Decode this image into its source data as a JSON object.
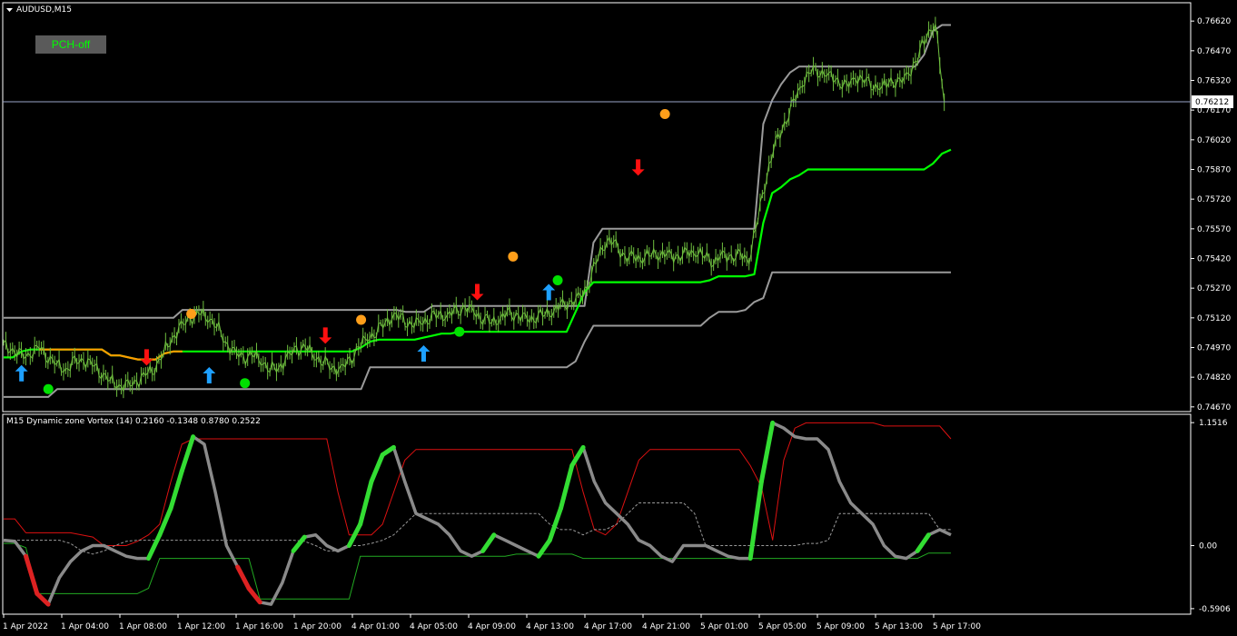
{
  "window": {
    "title": "AUDUSD,M15"
  },
  "button": {
    "label": "PCH-off"
  },
  "indicator": {
    "title": "M15 Dynamic zone Vortex (14) 0.2160 -0.1348 0.8780 0.2522"
  },
  "colors": {
    "background": "#000000",
    "frame": "#ffffff",
    "price": "#6fbf3f",
    "channel": "#9a9a9a",
    "baseline": "#00ff00",
    "baseline_alt": "#ff9900",
    "up_arrow": "#1ea0ff",
    "down_arrow": "#ff1010",
    "dot_green": "#00e000",
    "dot_orange": "#ff9f1a",
    "vortex": "#8a8a8a",
    "vortex_up": "#33dd33",
    "vortex_down": "#dd2222",
    "upper_zone": "#dd1111",
    "lower_zone": "#22aa22",
    "mid_zone": "#999999"
  },
  "chart_data": [
    {
      "type": "line",
      "title": "AUDUSD,M15",
      "x_labels": [
        "1 Apr 2022",
        "1 Apr 04:00",
        "1 Apr 08:00",
        "1 Apr 12:00",
        "1 Apr 16:00",
        "1 Apr 20:00",
        "4 Apr 01:00",
        "4 Apr 05:00",
        "4 Apr 09:00",
        "4 Apr 13:00",
        "4 Apr 17:00",
        "4 Apr 21:00",
        "5 Apr 01:00",
        "5 Apr 05:00",
        "5 Apr 09:00",
        "5 Apr 13:00",
        "5 Apr 17:00"
      ],
      "y_ticks": [
        "0.76620",
        "0.76470",
        "0.76320",
        "0.76170",
        "0.76020",
        "0.75870",
        "0.75720",
        "0.75570",
        "0.75420",
        "0.75270",
        "0.75120",
        "0.74970",
        "0.74820",
        "0.74670"
      ],
      "ylim": [
        0.7466,
        0.7663
      ],
      "current_price": "0.76212",
      "current_value": 0.76212,
      "series": [
        {
          "role": "price",
          "values": [
            0.7498,
            0.7496,
            0.7492,
            0.7494,
            0.7497,
            0.7493,
            0.7488,
            0.7486,
            0.7489,
            0.7491,
            0.7488,
            0.7485,
            0.748,
            0.7478,
            0.7477,
            0.748,
            0.7483,
            0.7487,
            0.7494,
            0.7502,
            0.7507,
            0.7512,
            0.7514,
            0.7513,
            0.7508,
            0.75,
            0.7494,
            0.7492,
            0.7493,
            0.7491,
            0.7486,
            0.7487,
            0.7492,
            0.7496,
            0.7497,
            0.7493,
            0.749,
            0.7487,
            0.7486,
            0.749,
            0.7497,
            0.7502,
            0.7505,
            0.751,
            0.7513,
            0.7511,
            0.7508,
            0.751,
            0.7512,
            0.7514,
            0.7513,
            0.7515,
            0.7517,
            0.7515,
            0.7512,
            0.751,
            0.7512,
            0.7514,
            0.7513,
            0.7511,
            0.7513,
            0.7514,
            0.7516,
            0.7518,
            0.752,
            0.7522,
            0.7531,
            0.7543,
            0.7552,
            0.7548,
            0.7543,
            0.7542,
            0.7543,
            0.7544,
            0.7545,
            0.7543,
            0.7543,
            0.7544,
            0.7546,
            0.7543,
            0.7541,
            0.7543,
            0.7543,
            0.7543,
            0.7542,
            0.7562,
            0.7585,
            0.76,
            0.761,
            0.762,
            0.7631,
            0.7637,
            0.7637,
            0.7634,
            0.7632,
            0.7628,
            0.7634,
            0.7632,
            0.763,
            0.7628,
            0.7632,
            0.763,
            0.7636,
            0.7643,
            0.7656,
            0.766,
            0.7621
          ]
        },
        {
          "role": "channel-upper",
          "values": [
            0.7512,
            0.7512,
            0.7512,
            0.7512,
            0.7512,
            0.7512,
            0.7512,
            0.7512,
            0.7512,
            0.7512,
            0.7512,
            0.7512,
            0.7512,
            0.7512,
            0.7512,
            0.7512,
            0.7512,
            0.7512,
            0.7512,
            0.7512,
            0.7516,
            0.7516,
            0.7516,
            0.7516,
            0.7516,
            0.7516,
            0.7516,
            0.7516,
            0.7516,
            0.7516,
            0.7516,
            0.7516,
            0.7516,
            0.7516,
            0.7516,
            0.7516,
            0.7516,
            0.7516,
            0.7516,
            0.7516,
            0.7516,
            0.7516,
            0.7516,
            0.7516,
            0.7516,
            0.7515,
            0.7515,
            0.7515,
            0.7518,
            0.7518,
            0.7518,
            0.7518,
            0.7518,
            0.7518,
            0.7518,
            0.7518,
            0.7518,
            0.7518,
            0.7518,
            0.7518,
            0.7518,
            0.7518,
            0.7518,
            0.7518,
            0.7518,
            0.7518,
            0.755,
            0.7557,
            0.7557,
            0.7557,
            0.7557,
            0.7557,
            0.7557,
            0.7557,
            0.7557,
            0.7557,
            0.7557,
            0.7557,
            0.7557,
            0.7557,
            0.7557,
            0.7557,
            0.7557,
            0.7557,
            0.7557,
            0.761,
            0.7622,
            0.763,
            0.7636,
            0.7639,
            0.7639,
            0.7639,
            0.7639,
            0.7639,
            0.7639,
            0.7639,
            0.7639,
            0.7639,
            0.7639,
            0.7639,
            0.7639,
            0.7639,
            0.7639,
            0.7645,
            0.7657,
            0.766,
            0.766
          ]
        },
        {
          "role": "channel-lower",
          "values": [
            0.7472,
            0.7472,
            0.7472,
            0.7472,
            0.7472,
            0.7472,
            0.7476,
            0.7476,
            0.7476,
            0.7476,
            0.7476,
            0.7476,
            0.7476,
            0.7476,
            0.7476,
            0.7476,
            0.7476,
            0.7476,
            0.7476,
            0.7476,
            0.7476,
            0.7476,
            0.7476,
            0.7476,
            0.7476,
            0.7476,
            0.7476,
            0.7476,
            0.7476,
            0.7476,
            0.7476,
            0.7476,
            0.7476,
            0.7476,
            0.7476,
            0.7476,
            0.7476,
            0.7476,
            0.7476,
            0.7476,
            0.7476,
            0.7487,
            0.7487,
            0.7487,
            0.7487,
            0.7487,
            0.7487,
            0.7487,
            0.7487,
            0.7487,
            0.7487,
            0.7487,
            0.7487,
            0.7487,
            0.7487,
            0.7487,
            0.7487,
            0.7487,
            0.7487,
            0.7487,
            0.7487,
            0.7487,
            0.7487,
            0.7487,
            0.749,
            0.75,
            0.7508,
            0.7508,
            0.7508,
            0.7508,
            0.7508,
            0.7508,
            0.7508,
            0.7508,
            0.7508,
            0.7508,
            0.7508,
            0.7508,
            0.7508,
            0.7512,
            0.7515,
            0.7515,
            0.7515,
            0.7516,
            0.752,
            0.7522,
            0.7535,
            0.7535,
            0.7535,
            0.7535,
            0.7535,
            0.7535,
            0.7535,
            0.7535,
            0.7535,
            0.7535,
            0.7535,
            0.7535,
            0.7535,
            0.7535,
            0.7535,
            0.7535,
            0.7535,
            0.7535,
            0.7535,
            0.7535,
            0.7535
          ]
        },
        {
          "role": "baseline",
          "values": [
            0.7492,
            0.7492,
            0.7495,
            0.7496,
            0.7496,
            0.7496,
            0.7496,
            0.7496,
            0.7496,
            0.7496,
            0.7496,
            0.7496,
            0.7493,
            0.7493,
            0.7492,
            0.7491,
            0.7491,
            0.7491,
            0.7494,
            0.7495,
            0.7495,
            0.7495,
            0.7495,
            0.7495,
            0.7495,
            0.7495,
            0.7495,
            0.7495,
            0.7495,
            0.7495,
            0.7495,
            0.7495,
            0.7495,
            0.7495,
            0.7495,
            0.7495,
            0.7495,
            0.7495,
            0.7495,
            0.7495,
            0.7497,
            0.75,
            0.7501,
            0.7501,
            0.7501,
            0.7501,
            0.7501,
            0.7502,
            0.7503,
            0.7504,
            0.7504,
            0.7505,
            0.7505,
            0.7505,
            0.7505,
            0.7505,
            0.7505,
            0.7505,
            0.7505,
            0.7505,
            0.7505,
            0.7505,
            0.7505,
            0.7505,
            0.7515,
            0.7525,
            0.753,
            0.753,
            0.753,
            0.753,
            0.753,
            0.753,
            0.753,
            0.753,
            0.753,
            0.753,
            0.753,
            0.753,
            0.753,
            0.7531,
            0.7533,
            0.7533,
            0.7533,
            0.7533,
            0.7534,
            0.756,
            0.7575,
            0.7578,
            0.7582,
            0.7584,
            0.7587,
            0.7587,
            0.7587,
            0.7587,
            0.7587,
            0.7587,
            0.7587,
            0.7587,
            0.7587,
            0.7587,
            0.7587,
            0.7587,
            0.7587,
            0.7587,
            0.759,
            0.7595,
            0.7597
          ]
        }
      ],
      "signals": [
        {
          "type": "up-arrow",
          "i": 2,
          "y": 0.7484
        },
        {
          "type": "dot-green",
          "i": 5,
          "y": 0.7476
        },
        {
          "type": "down-arrow",
          "i": 16,
          "y": 0.7492
        },
        {
          "type": "dot-orange",
          "i": 21,
          "y": 0.7514
        },
        {
          "type": "up-arrow",
          "i": 23,
          "y": 0.7483
        },
        {
          "type": "dot-green",
          "i": 27,
          "y": 0.7479
        },
        {
          "type": "down-arrow",
          "i": 36,
          "y": 0.7503
        },
        {
          "type": "dot-orange",
          "i": 40,
          "y": 0.7511
        },
        {
          "type": "up-arrow",
          "i": 47,
          "y": 0.7494
        },
        {
          "type": "dot-green",
          "i": 51,
          "y": 0.7505
        },
        {
          "type": "down-arrow",
          "i": 53,
          "y": 0.7525
        },
        {
          "type": "dot-orange",
          "i": 57,
          "y": 0.7543
        },
        {
          "type": "up-arrow",
          "i": 61,
          "y": 0.7525
        },
        {
          "type": "dot-green",
          "i": 62,
          "y": 0.7531
        },
        {
          "type": "down-arrow",
          "i": 71,
          "y": 0.7588
        },
        {
          "type": "dot-orange",
          "i": 74,
          "y": 0.7615
        }
      ]
    },
    {
      "type": "line",
      "title": "M15 Dynamic zone Vortex (14) 0.2160 -0.1348 0.8780 0.2522",
      "y_ticks": [
        "1.1516",
        "0.00",
        "-0.5906"
      ],
      "ylim": [
        -0.6,
        1.17
      ],
      "series": [
        {
          "role": "vortex",
          "values": [
            0.05,
            0.04,
            -0.1,
            -0.45,
            -0.55,
            -0.3,
            -0.15,
            -0.05,
            0.0,
            0.0,
            -0.05,
            -0.1,
            -0.12,
            -0.12,
            0.1,
            0.35,
            0.7,
            1.02,
            0.95,
            0.5,
            0.0,
            -0.2,
            -0.4,
            -0.53,
            -0.55,
            -0.35,
            -0.05,
            0.08,
            0.1,
            0.0,
            -0.05,
            0.0,
            0.2,
            0.6,
            0.85,
            0.92,
            0.6,
            0.3,
            0.25,
            0.2,
            0.1,
            -0.05,
            -0.1,
            -0.05,
            0.1,
            0.05,
            0.0,
            -0.05,
            -0.1,
            0.05,
            0.35,
            0.75,
            0.92,
            0.6,
            0.4,
            0.3,
            0.2,
            0.05,
            0.0,
            -0.1,
            -0.15,
            0.0,
            0.0,
            0.0,
            -0.05,
            -0.1,
            -0.12,
            -0.12,
            0.6,
            1.15,
            1.1,
            1.02,
            1.0,
            1.0,
            0.9,
            0.6,
            0.4,
            0.3,
            0.2,
            0.0,
            -0.1,
            -0.12,
            -0.05,
            0.1,
            0.15,
            0.1
          ]
        },
        {
          "role": "upper-zone",
          "values": [
            0.25,
            0.25,
            0.12,
            0.12,
            0.12,
            0.12,
            0.12,
            0.1,
            0.08,
            0.0,
            0.0,
            0.0,
            0.04,
            0.1,
            0.2,
            0.6,
            0.95,
            1.0,
            1.0,
            1.0,
            1.0,
            1.0,
            1.0,
            1.0,
            1.0,
            1.0,
            1.0,
            1.0,
            1.0,
            1.0,
            0.5,
            0.1,
            0.1,
            0.1,
            0.2,
            0.5,
            0.8,
            0.9,
            0.9,
            0.9,
            0.9,
            0.9,
            0.9,
            0.9,
            0.9,
            0.9,
            0.9,
            0.9,
            0.9,
            0.9,
            0.9,
            0.9,
            0.5,
            0.15,
            0.1,
            0.2,
            0.5,
            0.8,
            0.9,
            0.9,
            0.9,
            0.9,
            0.9,
            0.9,
            0.9,
            0.9,
            0.9,
            0.75,
            0.55,
            0.05,
            0.8,
            1.1,
            1.15,
            1.15,
            1.15,
            1.15,
            1.15,
            1.15,
            1.15,
            1.12,
            1.12,
            1.12,
            1.12,
            1.12,
            1.12,
            1.0
          ]
        },
        {
          "role": "lower-zone",
          "values": [
            0.02,
            0.02,
            -0.02,
            -0.45,
            -0.45,
            -0.45,
            -0.45,
            -0.45,
            -0.45,
            -0.45,
            -0.45,
            -0.45,
            -0.45,
            -0.4,
            -0.12,
            -0.12,
            -0.12,
            -0.12,
            -0.12,
            -0.12,
            -0.12,
            -0.12,
            -0.12,
            -0.5,
            -0.5,
            -0.5,
            -0.5,
            -0.5,
            -0.5,
            -0.5,
            -0.5,
            -0.5,
            -0.1,
            -0.1,
            -0.1,
            -0.1,
            -0.1,
            -0.1,
            -0.1,
            -0.1,
            -0.1,
            -0.1,
            -0.1,
            -0.1,
            -0.1,
            -0.1,
            -0.08,
            -0.08,
            -0.08,
            -0.08,
            -0.08,
            -0.08,
            -0.12,
            -0.12,
            -0.12,
            -0.12,
            -0.12,
            -0.12,
            -0.12,
            -0.12,
            -0.12,
            -0.12,
            -0.12,
            -0.12,
            -0.12,
            -0.12,
            -0.12,
            -0.12,
            -0.12,
            -0.12,
            -0.12,
            -0.12,
            -0.12,
            -0.12,
            -0.12,
            -0.12,
            -0.12,
            -0.12,
            -0.12,
            -0.12,
            -0.12,
            -0.12,
            -0.12,
            -0.07,
            -0.07,
            -0.07
          ]
        },
        {
          "role": "mid-zone",
          "values": [
            0.05,
            0.05,
            0.05,
            0.05,
            0.05,
            0.05,
            0.02,
            -0.05,
            -0.08,
            -0.05,
            0.0,
            0.04,
            0.05,
            0.05,
            0.05,
            0.05,
            0.05,
            0.05,
            0.05,
            0.05,
            0.05,
            0.05,
            0.05,
            0.05,
            0.05,
            0.05,
            0.05,
            0.04,
            0.0,
            -0.05,
            -0.05,
            0.0,
            0.0,
            0.02,
            0.05,
            0.1,
            0.2,
            0.3,
            0.3,
            0.3,
            0.3,
            0.3,
            0.3,
            0.3,
            0.3,
            0.3,
            0.3,
            0.3,
            0.3,
            0.2,
            0.15,
            0.15,
            0.1,
            0.15,
            0.15,
            0.2,
            0.3,
            0.4,
            0.4,
            0.4,
            0.4,
            0.4,
            0.3,
            0.0,
            0.0,
            0.0,
            0.0,
            0.0,
            0.0,
            0.0,
            0.0,
            0.0,
            0.02,
            0.02,
            0.05,
            0.3,
            0.3,
            0.3,
            0.3,
            0.3,
            0.3,
            0.3,
            0.3,
            0.3,
            0.15,
            0.15
          ]
        }
      ]
    }
  ]
}
